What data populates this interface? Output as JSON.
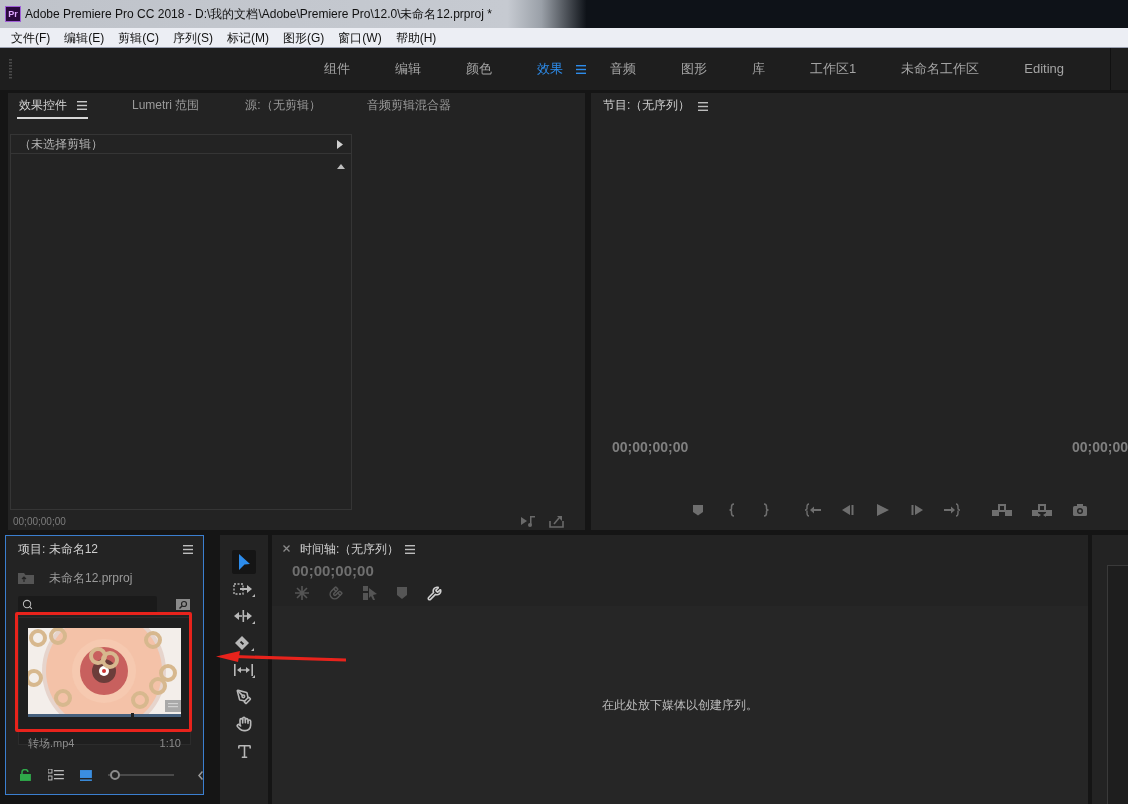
{
  "window": {
    "app_icon": "Pr",
    "title": "Adobe Premiere Pro CC 2018 - D:\\我的文档\\Adobe\\Premiere Pro\\12.0\\未命名12.prproj *"
  },
  "menu": [
    "文件(F)",
    "编辑(E)",
    "剪辑(C)",
    "序列(S)",
    "标记(M)",
    "图形(G)",
    "窗口(W)",
    "帮助(H)"
  ],
  "workspaces": [
    {
      "label": "组件",
      "selected": false
    },
    {
      "label": "编辑",
      "selected": false
    },
    {
      "label": "颜色",
      "selected": false
    },
    {
      "label": "效果",
      "selected": true
    },
    {
      "label": "音频",
      "selected": false
    },
    {
      "label": "图形",
      "selected": false
    },
    {
      "label": "库",
      "selected": false
    },
    {
      "label": "工作区1",
      "selected": false
    },
    {
      "label": "未命名工作区",
      "selected": false
    },
    {
      "label": "Editing",
      "selected": false
    }
  ],
  "effect_controls": {
    "tabs": [
      {
        "label": "效果控件",
        "selected": true
      },
      {
        "label": "Lumetri 范围",
        "selected": false
      },
      {
        "label": "源:（无剪辑）",
        "selected": false
      },
      {
        "label": "音频剪辑混合器",
        "selected": false
      }
    ],
    "clip_header": "（未选择剪辑）",
    "timecode": "00;00;00;00"
  },
  "program_monitor": {
    "title": "节目:（无序列）",
    "timecode_left": "00;00;00;00",
    "timecode_right": "00;00;00"
  },
  "project": {
    "title": "项目: 未命名12",
    "focused": true,
    "file": "未命名12.prproj",
    "items": [
      {
        "name": "转场.mp4",
        "duration": "1:10",
        "scrub": {
          "level": 0.67
        }
      }
    ],
    "zoom": {
      "level": 0.03
    }
  },
  "tools": [
    {
      "kind": "selection",
      "selected": true
    },
    {
      "kind": "track-select",
      "selected": false
    },
    {
      "kind": "ripple",
      "selected": false
    },
    {
      "kind": "razor",
      "selected": false
    },
    {
      "kind": "slip",
      "selected": false
    },
    {
      "kind": "pen",
      "selected": false
    },
    {
      "kind": "hand",
      "selected": false
    },
    {
      "kind": "text",
      "selected": false
    }
  ],
  "timeline": {
    "title": "时间轴:（无序列）",
    "timecode": "00;00;00;00",
    "drop_hint": "在此处放下媒体以创建序列。"
  },
  "annotation": {
    "kind": "box-with-arrow"
  }
}
